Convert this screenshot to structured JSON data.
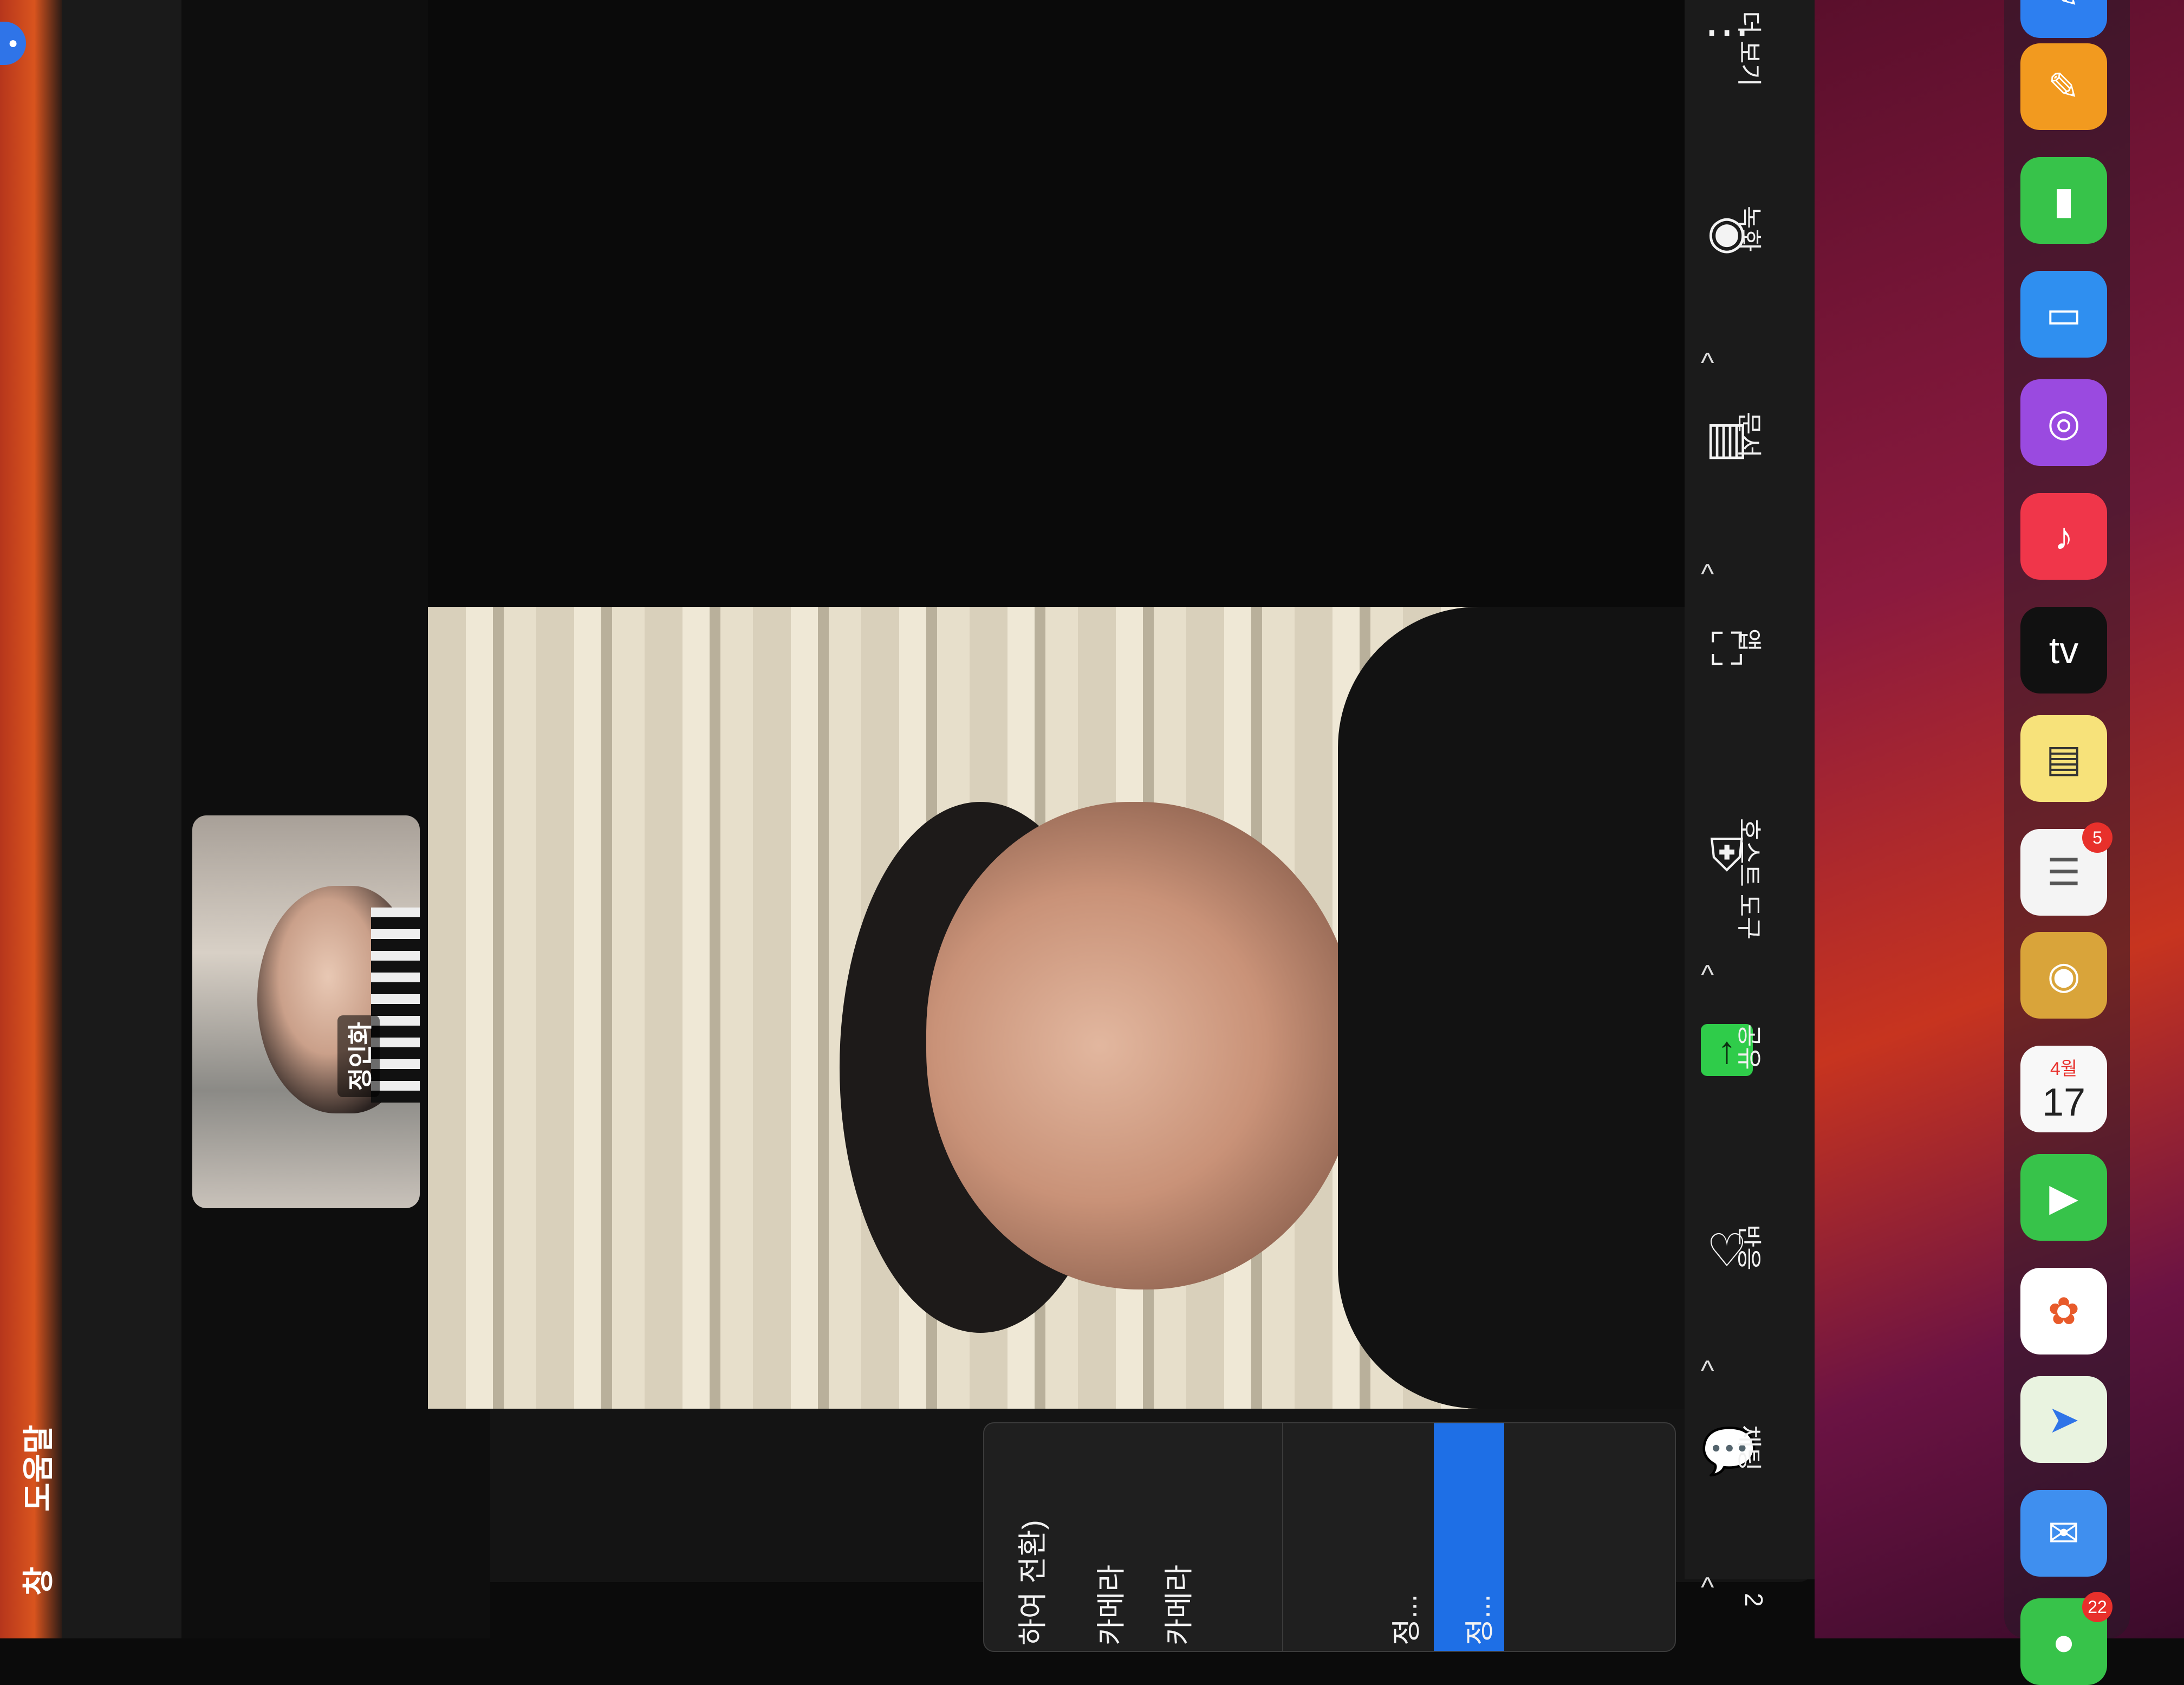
{
  "menubar": {
    "help": "도움말",
    "window": "창"
  },
  "participant": {
    "name": "정인화"
  },
  "context_menu": {
    "items": [
      "하여 전환)",
      "카메라",
      "카메라",
      "정...",
      "정..."
    ]
  },
  "toolbar": {
    "items": [
      {
        "icon": "more-icon",
        "label": "더 보기"
      },
      {
        "icon": "record-icon",
        "label": "녹화"
      },
      {
        "icon": "docs-icon",
        "label": "문서"
      },
      {
        "icon": "apps-icon",
        "label": "앱"
      },
      {
        "icon": "shield-icon",
        "label": "호스트 도구"
      },
      {
        "icon": "share-icon",
        "label": "공유"
      },
      {
        "icon": "heart-icon",
        "label": "반응"
      },
      {
        "icon": "chat-icon",
        "label": "채팅"
      }
    ],
    "participants_count": "2"
  },
  "dock": {
    "calendar_month": "4월",
    "calendar_day": "17",
    "reminders_badge": "5",
    "messages_badge": "22",
    "tv_label": "tv"
  },
  "colors": {
    "share_green": "#2fcc4a",
    "menu_highlight": "#1e6fe6",
    "badge_red": "#e8302b"
  }
}
